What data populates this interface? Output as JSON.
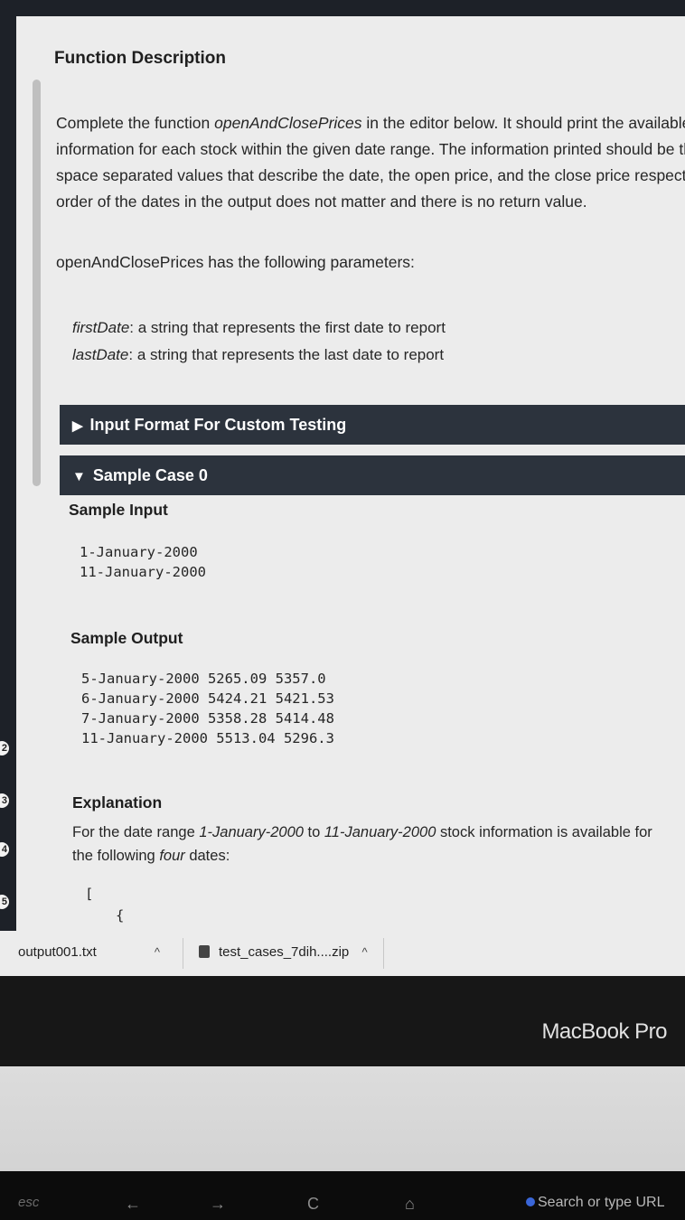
{
  "line_numbers": [
    "2",
    "3",
    "4",
    "5"
  ],
  "description": {
    "title": "Function Description",
    "p_prefix": "Complete the function ",
    "p_func": "openAndClosePrices",
    "p_line1_rest": " in the editor below.   It should print the available st",
    "p_line2": "information for each stock within the given date range.  The information printed should be three",
    "p_line3": "space separated values that describe the date, the open price, and the close price respectively.",
    "p_line4": "order of the dates in the output does not matter and there is no return value.",
    "params_intro": "openAndClosePrices has the following parameters:",
    "param1_name": "firstDate",
    "param1_desc": ": a string that represents the first date to report",
    "param2_name": "lastDate",
    "param2_desc": ": a string that represents the last date to report"
  },
  "sections": {
    "input_format_label": "Input Format For Custom Testing",
    "sample_case_label": "Sample Case 0",
    "collapsed_triangle": "▶",
    "expanded_triangle": "▼"
  },
  "sample": {
    "input_heading": "Sample Input",
    "input_lines": "1-January-2000\n11-January-2000",
    "output_heading": "Sample Output",
    "output_lines": "5-January-2000 5265.09 5357.0\n6-January-2000 5424.21 5421.53\n7-January-2000 5358.28 5414.48\n11-January-2000 5513.04 5296.3",
    "explanation_heading": "Explanation",
    "explanation_prefix": "For the date range ",
    "explanation_range": "1-January-2000",
    "explanation_to": " to ",
    "explanation_range2": "11-January-2000",
    "explanation_mid": " stock information is available for the following ",
    "explanation_four": "four",
    "explanation_suffix": " dates:",
    "code_bracket": "[",
    "code_brace": "{"
  },
  "downloads": {
    "file1": "output001.txt",
    "file2": "test_cases_7dih....zip",
    "caret": "^"
  },
  "device": {
    "brand_label": "MacBook Pro"
  },
  "touchbar": {
    "esc": "esc",
    "back": "←",
    "forward": "→",
    "reload": "C",
    "home": "⌂",
    "search_placeholder": "Search or type URL"
  }
}
